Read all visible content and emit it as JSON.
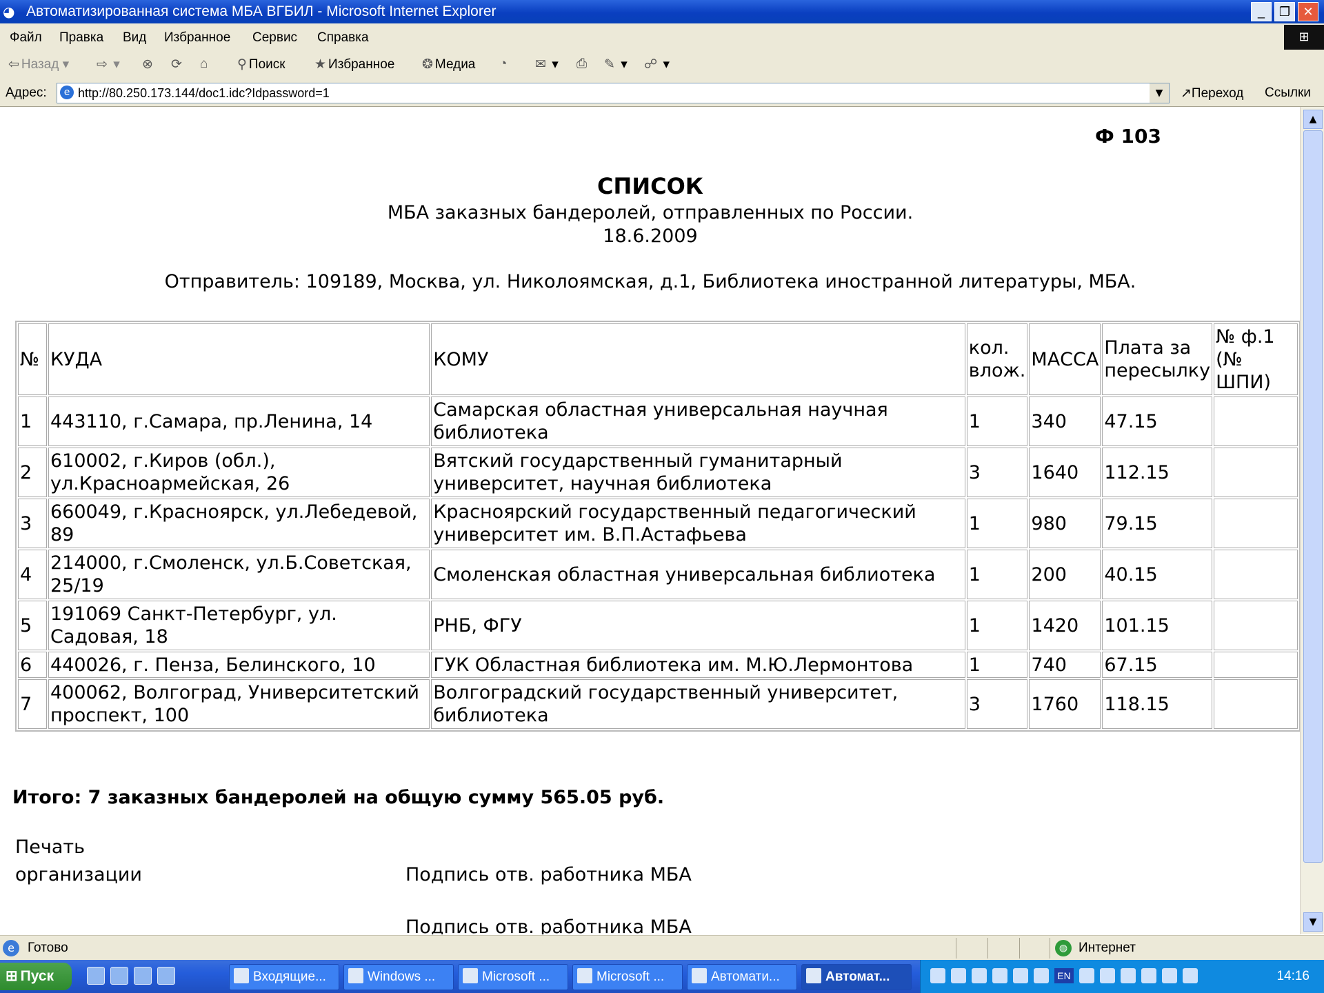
{
  "window": {
    "title": "Автоматизированная система МБА ВГБИЛ - Microsoft Internet Explorer",
    "min": "_",
    "restore": "❐",
    "close": "✕"
  },
  "menu": [
    "Файл",
    "Правка",
    "Вид",
    "Избранное",
    "Сервис",
    "Справка"
  ],
  "toolbar": {
    "back": "Назад",
    "search": "Поиск",
    "favorites": "Избранное",
    "media": "Медиа"
  },
  "address": {
    "label": "Адрес:",
    "url": "http://80.250.173.144/doc1.idc?Idpassword=1",
    "go": "Переход",
    "links": "Ссылки"
  },
  "document": {
    "form_number": "Ф 103",
    "title": "СПИСОК",
    "subtitle": "МБА заказных бандеролей, отправленных по России.",
    "date": "18.6.2009",
    "sender": "Отправитель: 109189, Москва, ул. Николоямская, д.1, Библиотека иностранной литературы, МБА.",
    "columns": [
      "№",
      "КУДА",
      "КОМУ",
      "кол. влож.",
      "МАССА",
      "Плата за пересылку",
      "№ ф.1 (№ ШПИ)"
    ],
    "rows": [
      [
        "1",
        "443110, г.Самара, пр.Ленина, 14",
        "Самарская областная универсальная научная библиотека",
        "1",
        "340",
        "47.15",
        ""
      ],
      [
        "2",
        "610002, г.Киров (обл.), ул.Красноармейская, 26",
        "Вятский государственный гуманитарный университет, научная библиотека",
        "3",
        "1640",
        "112.15",
        ""
      ],
      [
        "3",
        "660049, г.Красноярск, ул.Лебедевой, 89",
        "Красноярский государственный педагогический университет им. В.П.Астафьева",
        "1",
        "980",
        "79.15",
        ""
      ],
      [
        "4",
        "214000, г.Смоленск, ул.Б.Советская, 25/19",
        "Смоленская областная универсальная библиотека",
        "1",
        "200",
        "40.15",
        ""
      ],
      [
        "5",
        "191069 Санкт-Петербург, ул. Садовая, 18",
        "РНБ, ФГУ",
        "1",
        "1420",
        "101.15",
        ""
      ],
      [
        "6",
        "440026, г. Пенза, Белинского, 10",
        "ГУК Областная библиотека им. М.Ю.Лермонтова",
        "1",
        "740",
        "67.15",
        ""
      ],
      [
        "7",
        "400062, Волгоград, Университетский проспект, 100",
        "Волгоградский государственный университет, библиотека",
        "3",
        "1760",
        "118.15",
        ""
      ]
    ],
    "total": "Итого: 7 заказных бандеролей на общую сумму 565.05 руб.",
    "stamp_line1": "Печать",
    "stamp_line2": "организации",
    "signature1": "Подпись отв. работника МБА",
    "signature2": "Подпись отв. работника МБА"
  },
  "status": {
    "text": "Готово",
    "zone": "Интернет"
  },
  "taskbar": {
    "start": "Пуск",
    "tasks": [
      "Входящие...",
      "Windows ...",
      "Microsoft ...",
      "Microsoft ...",
      "Автомати...",
      "Автомат..."
    ],
    "tray_lang": "EN",
    "clock": "14:16"
  }
}
